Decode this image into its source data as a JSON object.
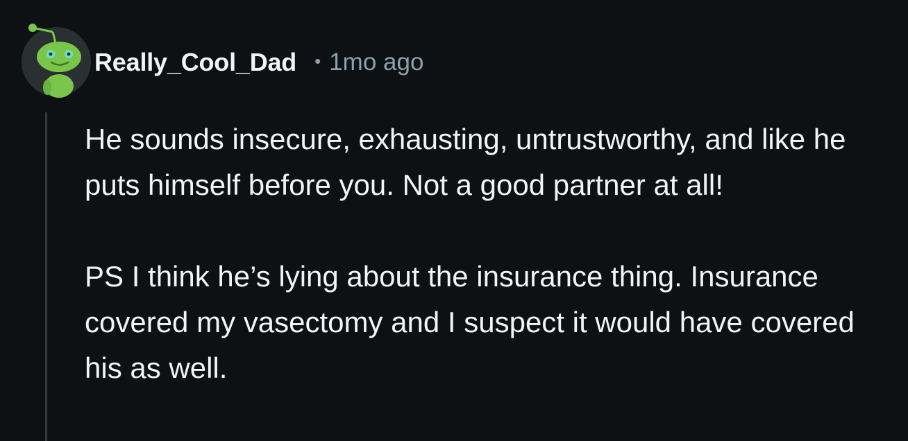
{
  "comment": {
    "avatar_icon": "snoo-avatar-icon",
    "username": "Really_Cool_Dad",
    "separator": "•",
    "timestamp": "1mo ago",
    "paragraphs": [
      "He sounds insecure, exhausting, untrustworthy, and like he puts himself before you. Not a good partner at all!",
      "PS I think he’s lying about the insurance thing. Insurance covered my vasectomy and I suspect it would have covered his as well."
    ]
  },
  "colors": {
    "background": "#0e1113",
    "text": "#f2f4f5",
    "meta": "#8ba2ad",
    "thread_line": "#33393c",
    "avatar_green": "#79c64a"
  }
}
